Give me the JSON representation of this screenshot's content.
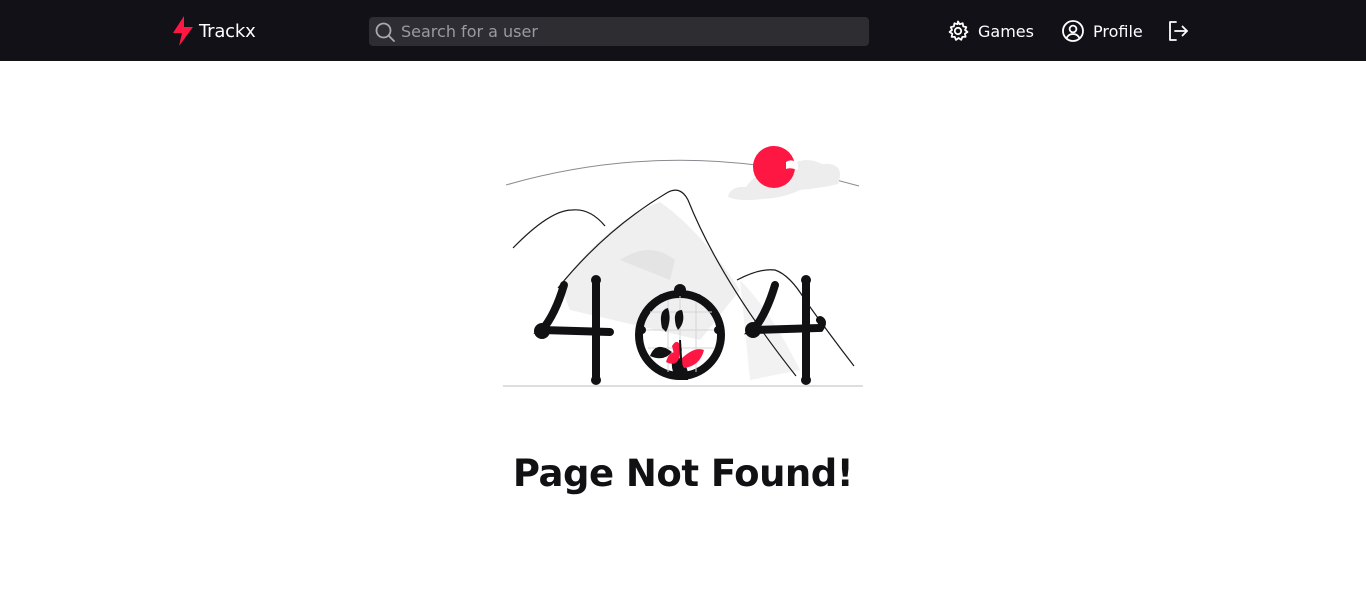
{
  "brand": {
    "name": "Trackx",
    "accent_color": "#ff1744",
    "logo_icon": "lightning-bolt-icon"
  },
  "search": {
    "placeholder": "Search for a user",
    "value": "",
    "icon": "search-icon"
  },
  "nav": {
    "items": [
      {
        "label": "Games",
        "icon": "gear-icon"
      },
      {
        "label": "Profile",
        "icon": "user-circle-icon"
      },
      {
        "label": "",
        "icon": "logout-icon"
      }
    ]
  },
  "main": {
    "illustration": "404-mountains-illustration",
    "title": "Page Not Found!"
  },
  "colors": {
    "navbar_bg": "#111117",
    "search_bg": "#2d2d32",
    "page_bg": "#ffffff",
    "accent": "#ff1744"
  }
}
